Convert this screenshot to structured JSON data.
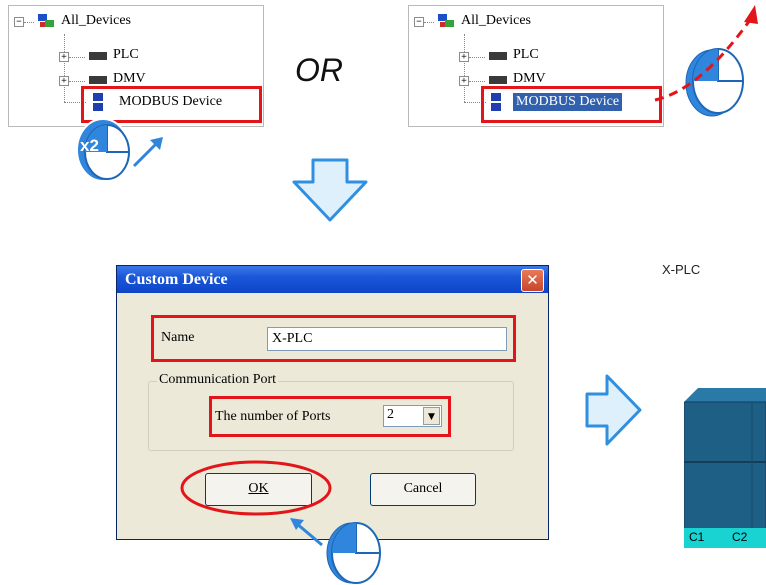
{
  "tree": {
    "root_label": "All_Devices",
    "items": [
      "PLC",
      "DMV",
      "MODBUS Device"
    ],
    "expander_collapsed": "+",
    "expander_expanded": "−"
  },
  "or_label": "OR",
  "double_click_badge": "x2",
  "dialog": {
    "title": "Custom Device",
    "close_glyph": "✕",
    "name_label": "Name",
    "name_value": "X-PLC",
    "group_label": "Communication Port",
    "ports_label": "The number of Ports",
    "ports_value": "2",
    "dropdown_glyph": "▼",
    "ok_label": "OK",
    "cancel_label": "Cancel"
  },
  "result": {
    "device_name": "X-PLC",
    "ports": [
      "C1",
      "C2"
    ]
  },
  "colors": {
    "highlight_red": "#e3151a",
    "arrow_blue": "#2f8fe0",
    "device_fill": "#1e5f86",
    "port_strip": "#19d2d2"
  },
  "icons": [
    "mouse-icon",
    "network-tree-icon",
    "device-bar-icon",
    "modbus-device-icon",
    "down-arrow-icon",
    "right-arrow-icon",
    "close-icon"
  ]
}
